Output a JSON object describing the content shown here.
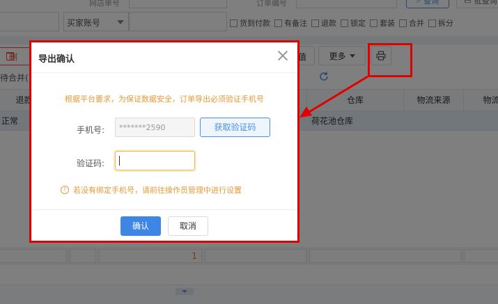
{
  "filters": {
    "row1": {
      "shop_order_label": "网店单号",
      "order_no_label": "订单编号",
      "query_label": "查询",
      "batch_query_label": "批查询"
    },
    "row2": {
      "buyer_account_select": "买家账号",
      "checkboxes": [
        "货到付款",
        "有备注",
        "退款",
        "锁定",
        "套装",
        "合并",
        "拆分"
      ]
    }
  },
  "toolbar": {
    "delete_label": "删",
    "hidden_label": "值",
    "more_label": "更多"
  },
  "merge_text": "待合并(",
  "table": {
    "headers": [
      "退款",
      "仓库",
      "物流来源",
      "物流"
    ],
    "row": {
      "status": "正常",
      "warehouse": "荷花池仓库"
    }
  },
  "footer": {
    "count": "1"
  },
  "modal": {
    "title": "导出确认",
    "notice": "根据平台要求，为保证数据安全，订单导出必须验证手机号",
    "phone_label": "手机号:",
    "phone_value": "*******2590",
    "get_code_label": "获取验证码",
    "code_label": "验证码:",
    "tip_icon": "!",
    "tip": "若没有绑定手机号，请前往操作员管理中进行设置",
    "confirm_label": "确认",
    "cancel_label": "取消"
  },
  "colors": {
    "highlight": "#e10000",
    "primary": "#3d86e6",
    "warning": "#e69a3a"
  }
}
